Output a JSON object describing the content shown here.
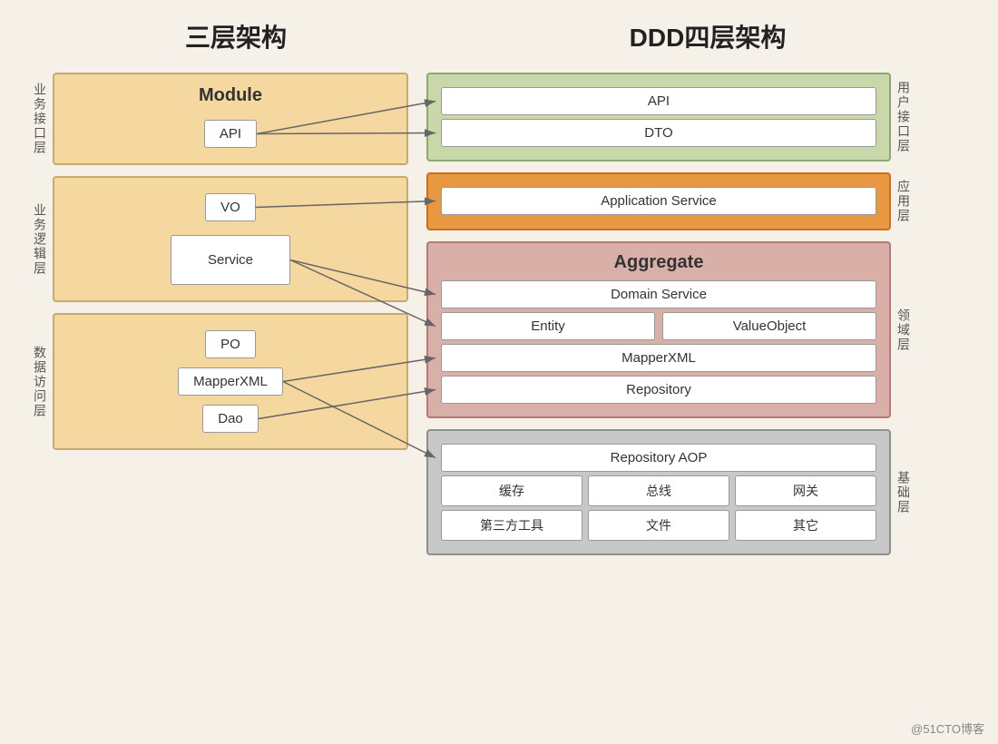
{
  "titles": {
    "left": "三层架构",
    "right": "DDD四层架构"
  },
  "left_layers": [
    {
      "id": "biz-interface",
      "label": "业务接口层",
      "title": "Module",
      "items": [
        "API"
      ]
    },
    {
      "id": "biz-logic",
      "label": "业务逻辑层",
      "items": [
        "VO",
        "Service"
      ]
    },
    {
      "id": "data-access",
      "label": "数据访问层",
      "items": [
        "PO",
        "MapperXML",
        "Dao"
      ]
    }
  ],
  "right_layers": [
    {
      "id": "user-interface",
      "label": "用户接口层",
      "type": "green",
      "items": [
        "API",
        "DTO"
      ]
    },
    {
      "id": "app-layer",
      "label": "应用层",
      "type": "orange",
      "title": "Application Service"
    },
    {
      "id": "domain-layer",
      "label": "领域层",
      "type": "pink",
      "title": "Aggregate",
      "items": [
        "Domain Service"
      ],
      "two_col": [
        "Entity",
        "ValueObject"
      ],
      "items2": [
        "MapperXML",
        "Repository"
      ]
    },
    {
      "id": "infra-layer",
      "label": "基础层",
      "type": "gray",
      "items": [
        "Repository AOP"
      ],
      "three_col1": [
        "缓存",
        "总线",
        "网关"
      ],
      "three_col2": [
        "第三方工具",
        "文件",
        "其它"
      ]
    }
  ],
  "watermark": "@51CTO博客"
}
